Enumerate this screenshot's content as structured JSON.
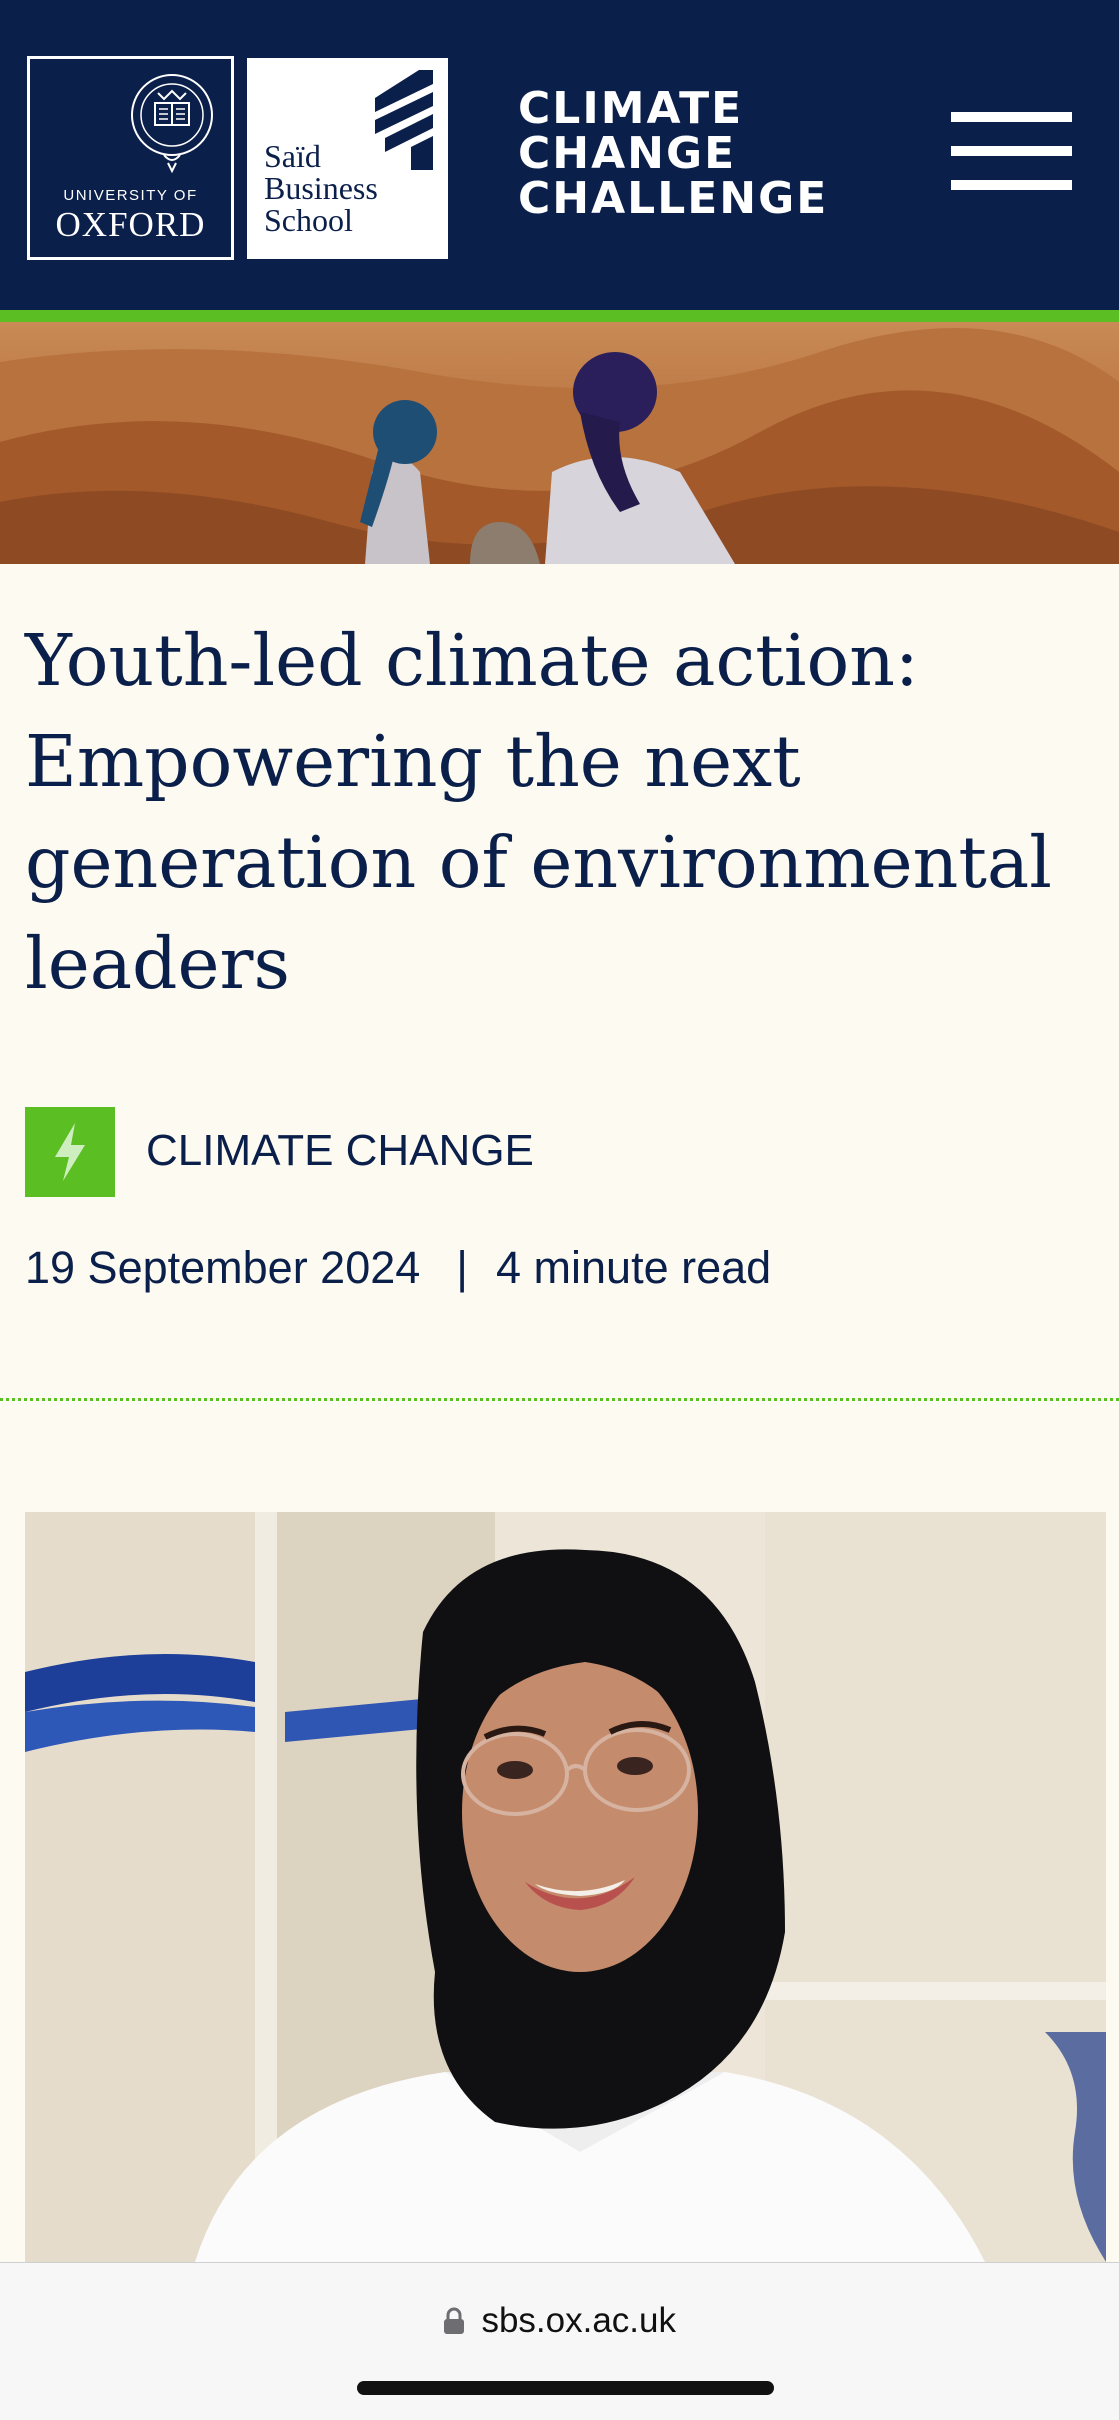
{
  "header": {
    "oxford_logo": {
      "line1": "UNIVERSITY OF",
      "line2": "OXFORD"
    },
    "said_logo": {
      "lines": [
        "Saïd",
        "Business",
        "School"
      ]
    },
    "challenge_logo": {
      "lines": [
        "CLIMATE",
        "CHANGE",
        "CHALLENGE"
      ]
    },
    "menu_icon": "hamburger-menu-icon",
    "background_color": "#0b1f4b",
    "accent_color": "#5bbe23"
  },
  "hero": {
    "image": "desert-dunes-two-people-photo"
  },
  "article": {
    "title": "Youth-led climate action: Empowering the next generation of environmental leaders",
    "category": {
      "label": "CLIMATE CHANGE",
      "icon": "lightning-bolt-icon"
    },
    "date": "19 September 2024",
    "separator": "|",
    "read_time": "4 minute read"
  },
  "portrait": {
    "image": "woman-in-hijab-portrait-photo"
  },
  "browser": {
    "url": "sbs.ox.ac.uk",
    "icon": "lock-icon"
  }
}
